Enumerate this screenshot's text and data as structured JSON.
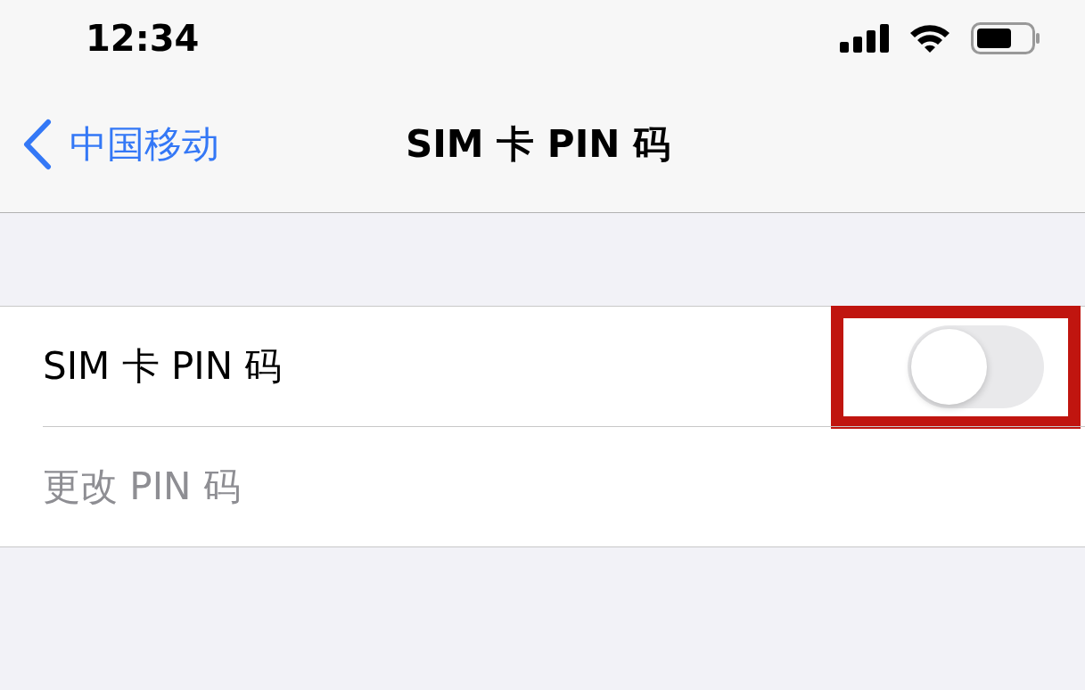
{
  "status_bar": {
    "time": "12:34"
  },
  "nav_bar": {
    "back": "中国移动",
    "title": "SIM 卡 PIN 码"
  },
  "rows": [
    {
      "kind": "toggle",
      "label": "SIM 卡 PIN 码",
      "on": false,
      "disabled": false,
      "highlighted": true
    },
    {
      "kind": "link",
      "label": "更改 PIN 码",
      "disabled": true,
      "highlighted": false
    }
  ]
}
